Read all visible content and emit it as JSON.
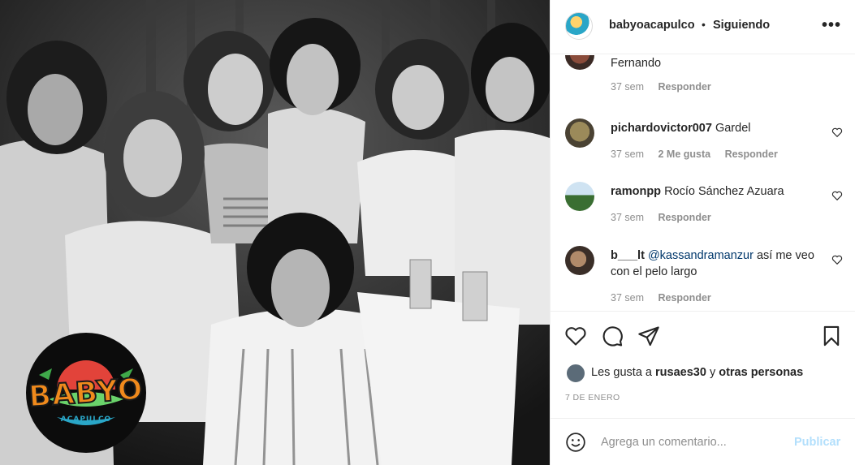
{
  "post": {
    "logo": {
      "text": "BABYO",
      "sub": "ACAPULCO"
    }
  },
  "header": {
    "username": "babyoacapulco",
    "separator": "•",
    "follow_status": "Siguiendo",
    "more_icon": "more-horizontal-icon"
  },
  "comments": [
    {
      "user": "",
      "text": "Fernando",
      "time": "37 sem",
      "likes": "",
      "reply": "Responder"
    },
    {
      "user": "pichardovictor007",
      "text": "Gardel",
      "time": "37 sem",
      "likes": "2 Me gusta",
      "reply": "Responder"
    },
    {
      "user": "ramonpp",
      "text": "Rocío Sánchez Azuara",
      "time": "37 sem",
      "likes": "",
      "reply": "Responder"
    },
    {
      "user": "b___lt",
      "mention": "@kassandramanzur",
      "text": "así me veo con el pelo largo",
      "time": "37 sem",
      "likes": "",
      "reply": "Responder"
    }
  ],
  "actions": {
    "icons": [
      "heart-icon",
      "comment-icon",
      "share-icon",
      "bookmark-icon"
    ]
  },
  "likes": {
    "prefix": "Les gusta a",
    "user": "rusaes30",
    "connector": "y",
    "others": "otras personas"
  },
  "date": "7 DE ENERO",
  "composer": {
    "placeholder": "Agrega un comentario...",
    "publish": "Publicar"
  },
  "colors": {
    "link": "#00376b",
    "muted": "#8e8e8e",
    "publish_disabled": "#b2dffc",
    "logo_orange": "#f08a1c",
    "logo_blue": "#2aa6c7"
  }
}
